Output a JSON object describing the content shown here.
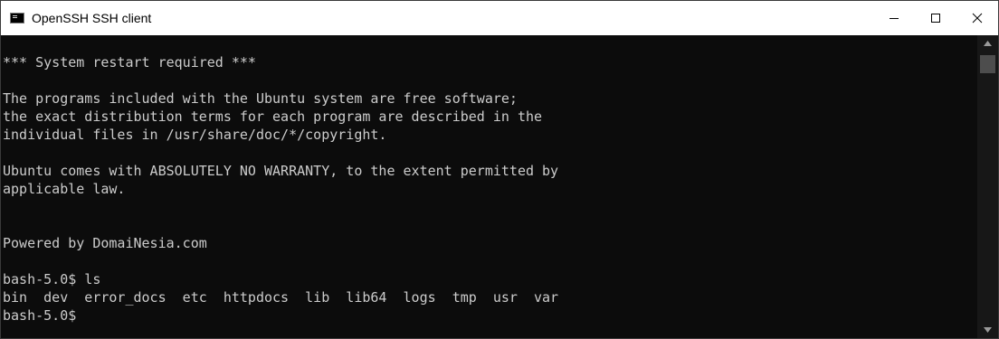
{
  "window": {
    "title": "OpenSSH SSH client",
    "icon": "console-app-icon"
  },
  "caption_buttons": {
    "minimize_icon": "minimize-icon",
    "maximize_icon": "maximize-icon",
    "close_icon": "close-icon"
  },
  "console": {
    "lines": [
      "*** System restart required ***",
      "",
      "The programs included with the Ubuntu system are free software;",
      "the exact distribution terms for each program are described in the",
      "individual files in /usr/share/doc/*/copyright.",
      "",
      "Ubuntu comes with ABSOLUTELY NO WARRANTY, to the extent permitted by",
      "applicable law.",
      "",
      "",
      "Powered by DomaiNesia.com",
      "",
      "bash-5.0$ ls",
      "bin  dev  error_docs  etc  httpdocs  lib  lib64  logs  tmp  usr  var",
      "bash-5.0$"
    ]
  },
  "colors": {
    "console_background": "#0c0c0c",
    "console_text": "#cccccc",
    "titlebar_background": "#ffffff",
    "scrollbar_track": "#171717",
    "scrollbar_thumb": "#4d4d4d"
  }
}
